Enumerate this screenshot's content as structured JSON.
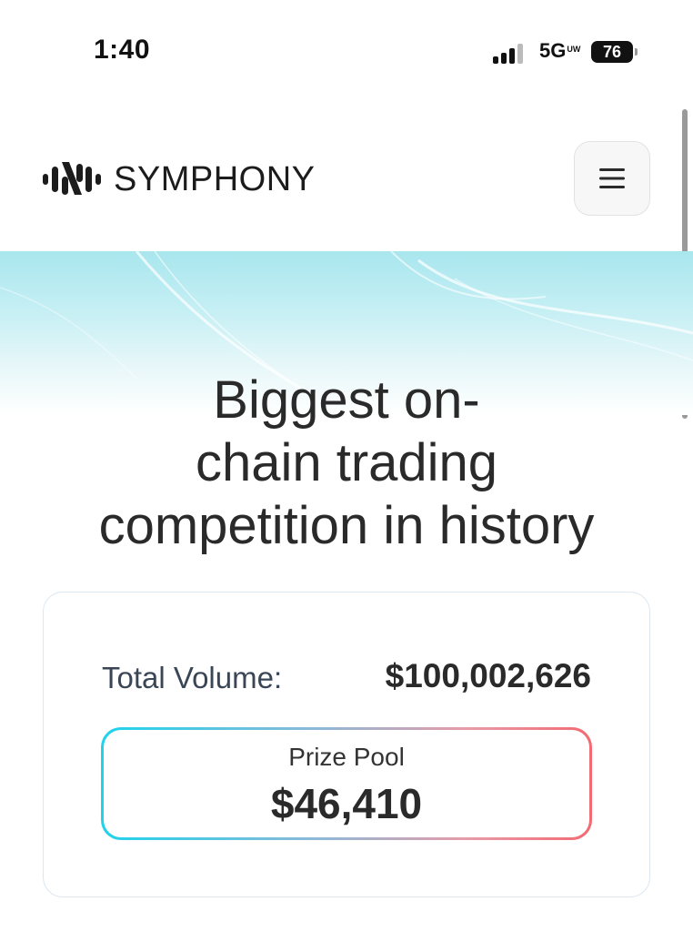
{
  "status_bar": {
    "time": "1:40",
    "network": "5G",
    "network_suffix": "UW",
    "battery": "76"
  },
  "header": {
    "brand": "SYMPHONY",
    "logo_icon": "symphony-waveform-logo",
    "menu_icon": "hamburger-icon"
  },
  "hero": {
    "headline_lines": [
      "Biggest on-",
      "chain trading",
      "competition in history"
    ]
  },
  "stats": {
    "total_volume_label": "Total Volume:",
    "total_volume_value": "$100,002,626",
    "prize_pool_label": "Prize Pool",
    "prize_pool_value": "$46,410"
  },
  "colors": {
    "prize_gradient_start": "#1fd3ec",
    "prize_gradient_end": "#f26a72",
    "hero_tint": "#a9e6ee"
  }
}
